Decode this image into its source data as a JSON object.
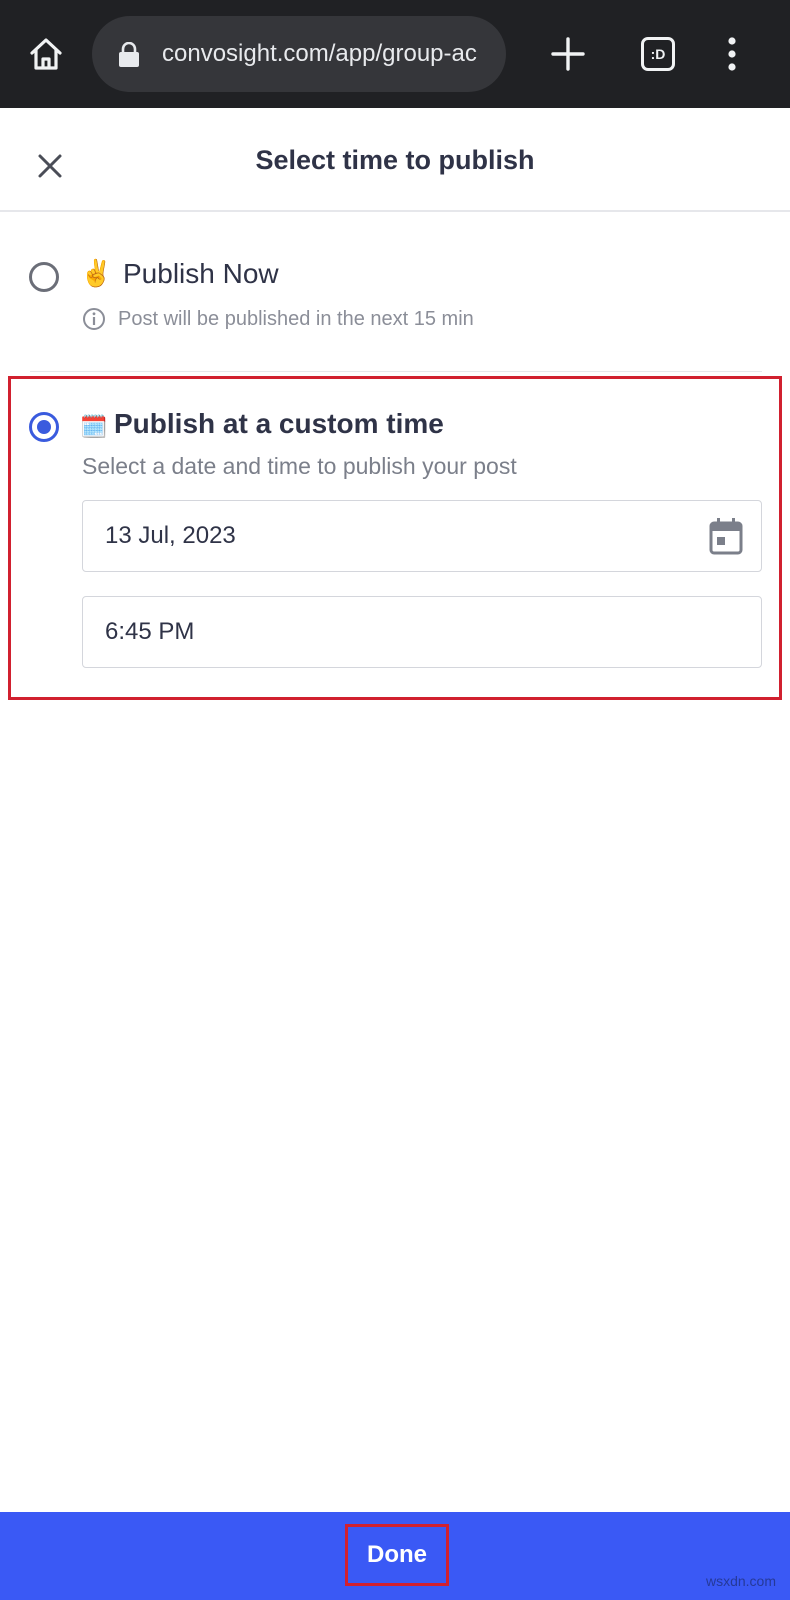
{
  "browser": {
    "url": "convosight.com/app/group-ac",
    "tab_count_label": ":D",
    "icons": [
      "home-icon",
      "lock-icon",
      "plus-icon",
      "tabs-icon",
      "more-vert-icon"
    ]
  },
  "dialog": {
    "title": "Select time to publish",
    "close_icon": "close-icon"
  },
  "options": {
    "now": {
      "emoji": "✌️",
      "label": "Publish Now",
      "note": "Post will be published in the next 15 min",
      "selected": false
    },
    "custom": {
      "emoji": "🗓️",
      "label": "Publish at a custom time",
      "description": "Select a date and time to publish your post",
      "selected": true,
      "date_value": "13 Jul, 2023",
      "time_value": "6:45 PM"
    }
  },
  "footer": {
    "done_label": "Done"
  },
  "watermark": "wsxdn.com",
  "colors": {
    "accent": "#3a5bde",
    "footer": "#3a59f5",
    "highlight": "#d1202f",
    "browser_bar": "#202124"
  }
}
